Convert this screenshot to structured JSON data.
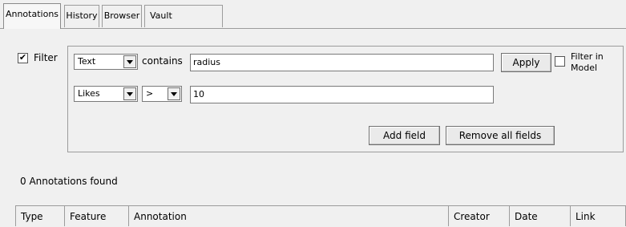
{
  "tabs": [
    {
      "label": "Annotations",
      "active": true
    },
    {
      "label": "History",
      "active": false
    },
    {
      "label": "Browser",
      "active": false
    },
    {
      "label": "Vault",
      "active": false
    }
  ],
  "filter": {
    "enabled_label": "Filter",
    "enabled": true,
    "row1": {
      "field": "Text",
      "operator_label": "contains",
      "value": "radius"
    },
    "row2": {
      "field": "Likes",
      "operator": ">",
      "value": "10"
    },
    "apply_label": "Apply",
    "filter_in_model_label_1": "Filter in",
    "filter_in_model_label_2": "Model",
    "filter_in_model_checked": false,
    "add_field_label": "Add field",
    "remove_all_label": "Remove all fields"
  },
  "status": {
    "found_text": "0 Annotations found"
  },
  "table": {
    "columns": [
      "Type",
      "Feature",
      "Annotation",
      "Creator",
      "Date",
      "Link"
    ]
  }
}
